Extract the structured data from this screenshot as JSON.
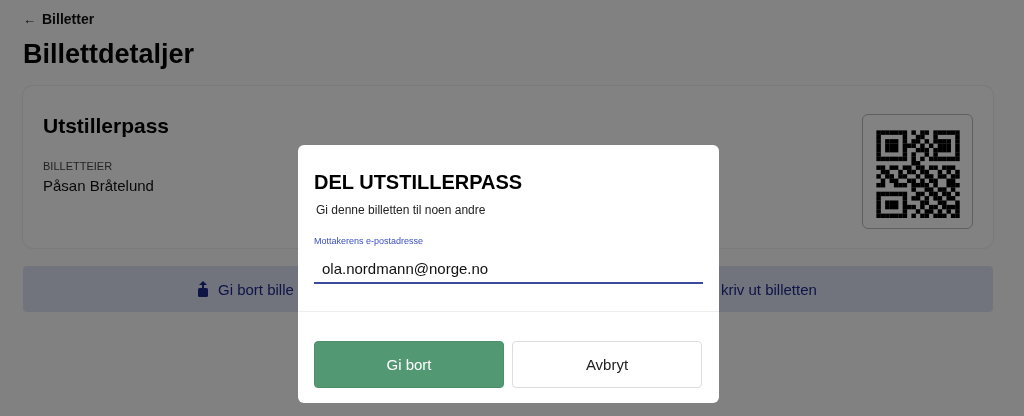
{
  "back_link": {
    "arrow": "←",
    "label": "Billetter"
  },
  "page_title": "Billettdetaljer",
  "ticket": {
    "name": "Utstillerpass",
    "owner_label": "BILLETTEIER",
    "owner": "Påsan Bråtelund"
  },
  "actions": [
    {
      "kind": "share",
      "label": "Gi bort bille"
    },
    {
      "kind": "print",
      "label": "kriv ut billetten"
    }
  ],
  "dialog": {
    "title": "DEL UTSTILLERPASS",
    "subtitle": "Gi denne billetten til noen andre",
    "field": {
      "label": "Mottakerens e-postadresse",
      "value": "ola.nordmann@norge.no"
    },
    "buttons": [
      {
        "kind": "primary",
        "label": "Gi bort"
      },
      {
        "kind": "secondary",
        "label": "Avbryt"
      }
    ]
  }
}
